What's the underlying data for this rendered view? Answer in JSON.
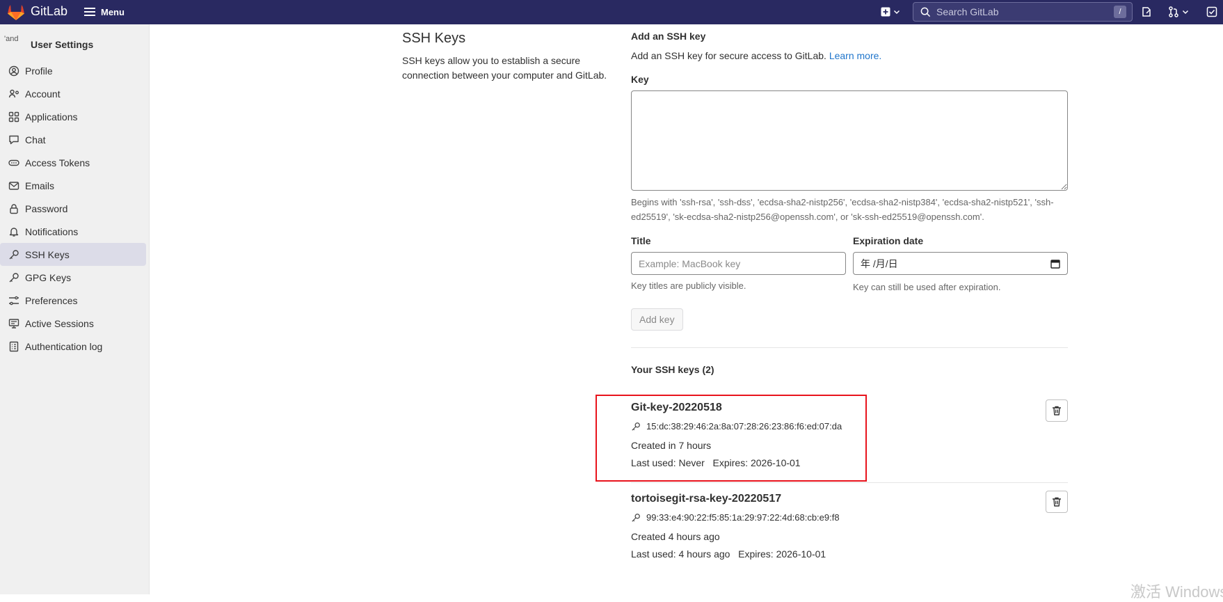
{
  "app": {
    "brand": "GitLab",
    "menu_label": "Menu"
  },
  "search": {
    "placeholder": "Search GitLab",
    "shortcut": "/"
  },
  "sidebar": {
    "avatar_alt": "'and",
    "title": "User Settings",
    "items": [
      {
        "label": "Profile",
        "icon": "profile-icon"
      },
      {
        "label": "Account",
        "icon": "account-icon"
      },
      {
        "label": "Applications",
        "icon": "applications-icon"
      },
      {
        "label": "Chat",
        "icon": "chat-icon"
      },
      {
        "label": "Access Tokens",
        "icon": "token-icon"
      },
      {
        "label": "Emails",
        "icon": "mail-icon"
      },
      {
        "label": "Password",
        "icon": "lock-icon"
      },
      {
        "label": "Notifications",
        "icon": "bell-icon"
      },
      {
        "label": "SSH Keys",
        "icon": "key-icon",
        "active": true
      },
      {
        "label": "GPG Keys",
        "icon": "key-icon"
      },
      {
        "label": "Preferences",
        "icon": "preferences-icon"
      },
      {
        "label": "Active Sessions",
        "icon": "monitor-icon"
      },
      {
        "label": "Authentication log",
        "icon": "log-icon"
      }
    ]
  },
  "page": {
    "title": "SSH Keys",
    "description": "SSH keys allow you to establish a secure connection between your computer and GitLab."
  },
  "add_form": {
    "title": "Add an SSH key",
    "description": "Add an SSH key for secure access to GitLab.",
    "learn_more": "Learn more.",
    "key_label": "Key",
    "key_value": "",
    "key_help": "Begins with 'ssh-rsa', 'ssh-dss', 'ecdsa-sha2-nistp256', 'ecdsa-sha2-nistp384', 'ecdsa-sha2-nistp521', 'ssh-ed25519', 'sk-ecdsa-sha2-nistp256@openssh.com', or 'sk-ssh-ed25519@openssh.com'.",
    "title_label": "Title",
    "title_placeholder": "Example: MacBook key",
    "title_help": "Key titles are publicly visible.",
    "expiration_label": "Expiration date",
    "expiration_value": "年 /月/日",
    "expiration_help": "Key can still be used after expiration.",
    "add_button": "Add key"
  },
  "keys": {
    "heading": "Your SSH keys (2)",
    "items": [
      {
        "name": "Git-key-20220518",
        "fingerprint": "15:dc:38:29:46:2a:8a:07:28:26:23:86:f6:ed:07:da",
        "created": "Created in 7 hours",
        "last_used": "Last used: Never",
        "expires": "Expires: 2026-10-01"
      },
      {
        "name": "tortoisegit-rsa-key-20220517",
        "fingerprint": "99:33:e4:90:22:f5:85:1a:29:97:22:4d:68:cb:e9:f8",
        "created": "Created 4 hours ago",
        "last_used": "Last used: 4 hours ago",
        "expires": "Expires: 2026-10-01"
      }
    ]
  },
  "watermark": "激活 Windows",
  "colors": {
    "topbar": "#292961",
    "link": "#1f75cb",
    "highlight": "#e8131c",
    "sidebar_bg": "#f0f0f0"
  }
}
